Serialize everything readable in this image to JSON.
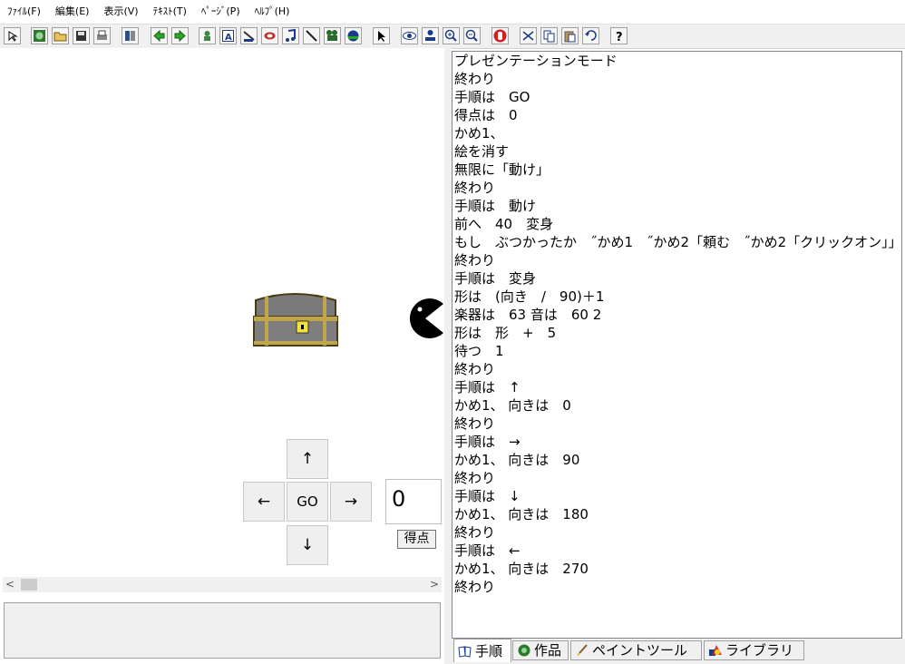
{
  "menu": [
    "ﾌｧｲﾙ(F)",
    "編集(E)",
    "表示(V)",
    "ﾃｷｽﾄ(T)",
    "ﾍﾟｰｼﾞ(P)",
    "ﾍﾙﾌﾟ(H)"
  ],
  "toolbar_icons": [
    "select-icon",
    "globe-icon",
    "open-folder-icon",
    "save-icon",
    "print-icon",
    "layout-icon",
    "back-arrow-icon",
    "forward-arrow-icon",
    "character-icon",
    "text-box-icon",
    "turtle-icon",
    "button-icon",
    "music-note-icon",
    "pen-icon",
    "camera-icon",
    "helmet-icon",
    "pointer-icon",
    "eye-icon",
    "stamp-icon",
    "zoom-in-icon",
    "zoom-out-icon",
    "stop-icon",
    "cut-icon",
    "copy-icon",
    "paste-icon",
    "undo-icon",
    "help-icon"
  ],
  "stage": {
    "pad": {
      "up": "↑",
      "left": "←",
      "go": "GO",
      "right": "→",
      "down": "↓"
    },
    "score_value": "0",
    "score_button": "得点"
  },
  "scroll": {
    "left": "<",
    "right": ">"
  },
  "code_lines": [
    "プレゼンテーションモード",
    "終わり",
    "手順は　GO",
    "得点は　0",
    "かめ1、",
    "絵を消す",
    "無限に「動け」",
    "終わり",
    "手順は　動け",
    "前へ　40　変身",
    "もし　ぶつかったか　˝かめ1　˝かめ2「頼む　˝かめ2「クリックオン」」",
    "終わり",
    "手順は　変身",
    "形は　(向き　/　90)＋1",
    "楽器は　63 音は　60 2",
    "形は　形　+　5",
    "待つ　1",
    "終わり",
    "手順は　↑",
    "かめ1、 向きは　0",
    "終わり",
    "手順は　→",
    "かめ1、 向きは　90",
    "終わり",
    "手順は　↓",
    "かめ1、 向きは　180",
    "終わり",
    "手順は　←",
    "かめ1、 向きは　270",
    "終わり"
  ],
  "tabs": [
    {
      "label": "手順",
      "icon": "book-icon",
      "active": true
    },
    {
      "label": "作品",
      "icon": "globe-icon",
      "active": false
    },
    {
      "label": "ペイントツール",
      "icon": "paint-brush-icon",
      "active": false
    },
    {
      "label": "ライブラリ",
      "icon": "shapes-icon",
      "active": false
    }
  ]
}
